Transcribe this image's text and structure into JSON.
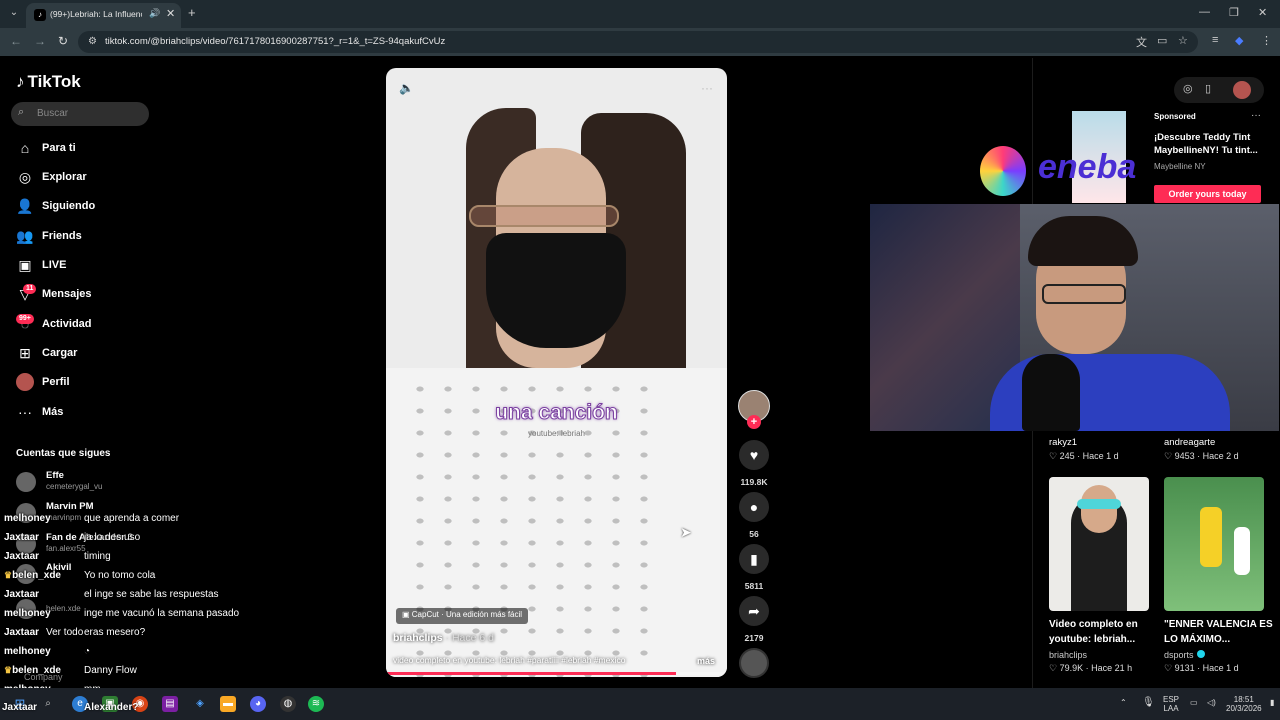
{
  "browser": {
    "tab_title": "(99+)Lebriah: La Influencia",
    "url": "tiktok.com/@briahclips/video/7617178016900287751?_r=1&_t=ZS-94qakufCvUz"
  },
  "sidebar": {
    "logo": "TikTok",
    "search_placeholder": "Buscar",
    "nav": [
      {
        "label": "Para ti",
        "icon": "home-icon"
      },
      {
        "label": "Explorar",
        "icon": "compass-icon"
      },
      {
        "label": "Siguiendo",
        "icon": "following-icon"
      },
      {
        "label": "Friends",
        "icon": "friends-icon"
      },
      {
        "label": "LIVE",
        "icon": "live-icon"
      },
      {
        "label": "Mensajes",
        "icon": "message-icon",
        "badge": "11"
      },
      {
        "label": "Actividad",
        "icon": "activity-icon",
        "badge": "99+"
      },
      {
        "label": "Cargar",
        "icon": "upload-icon"
      },
      {
        "label": "Perfil",
        "icon": "profile-icon"
      },
      {
        "label": "Más",
        "icon": "more-icon"
      }
    ],
    "following_title": "Cuentas que sigues",
    "accounts": [
      {
        "name": "Effe",
        "handle": "cemeterygal_vu"
      },
      {
        "name": "Marvin PM",
        "handle": "marvinpm"
      },
      {
        "name": "Fan de Alexander 3",
        "handle": "fan.alexr55"
      },
      {
        "name": "Akivil",
        "handle": ""
      },
      {
        "name": "",
        "handle": "belen.xde"
      }
    ],
    "footer_company": "Company"
  },
  "chat": [
    {
      "user": "melhoney",
      "msg": "que aprenda a comer"
    },
    {
      "user": "Jaxtaar",
      "msg": "ja lo des uso"
    },
    {
      "user": "Jaxtaar",
      "msg": "timing"
    },
    {
      "user": "belen_xde",
      "msg": "Yo no tomo cola",
      "crown": true
    },
    {
      "user": "Jaxtaar",
      "msg": "el inge se sabe las respuestas"
    },
    {
      "user": "melhoney",
      "msg": "inge me vacunó la semana pasado"
    },
    {
      "user": "Jaxtaar",
      "msg": "eras mesero?"
    },
    {
      "user": "melhoney",
      "msg": ""
    },
    {
      "user": "belen_xde",
      "msg": "Danny Flow",
      "crown": true
    },
    {
      "user": "melhoney",
      "msg": "mm"
    },
    {
      "user": "Jaxtaar",
      "msg": "Alexander?"
    }
  ],
  "chat_extra": {
    "ver_todo": "Ver todo"
  },
  "video": {
    "caption_big": "una canción",
    "caption_sub": "youtube: lebriah",
    "capcut": "CapCut · Una edición más fácil",
    "author": "briahclips",
    "time": "· Hace 6 d",
    "description": "video completo en youtube: lebriah #paratiiii #lebriah #mexico",
    "more": "más",
    "progress": 0.85
  },
  "actions": {
    "likes": "119.8K",
    "comments": "56",
    "saves": "5811",
    "shares": "2179"
  },
  "ad": {
    "sponsored": "Sponsored",
    "title": "¡Descubre Teddy Tint MaybellineNY! Tu tint...",
    "brand": "Maybelline NY",
    "cta": "Order yours today"
  },
  "overlay": {
    "eneba": "eneba"
  },
  "cards_top": [
    {
      "author": "rakyz1",
      "likes": "245",
      "time": "Hace 1 d"
    },
    {
      "author": "andreagarte",
      "likes": "9453",
      "time": "Hace 2 d"
    }
  ],
  "cards": [
    {
      "title": "Video completo en youtube: lebriah...",
      "author": "briahclips",
      "verified": false,
      "likes": "79.9K",
      "time": "Hace 21 h"
    },
    {
      "title": "\"ENNER VALENCIA ES LO MÁXIMO...",
      "author": "dsports",
      "verified": true,
      "likes": "9131",
      "time": "Hace 1 d"
    }
  ],
  "taskbar": {
    "lang_top": "ESP",
    "lang_bottom": "LAA",
    "time": "18:51",
    "date": "20/3/2026"
  }
}
